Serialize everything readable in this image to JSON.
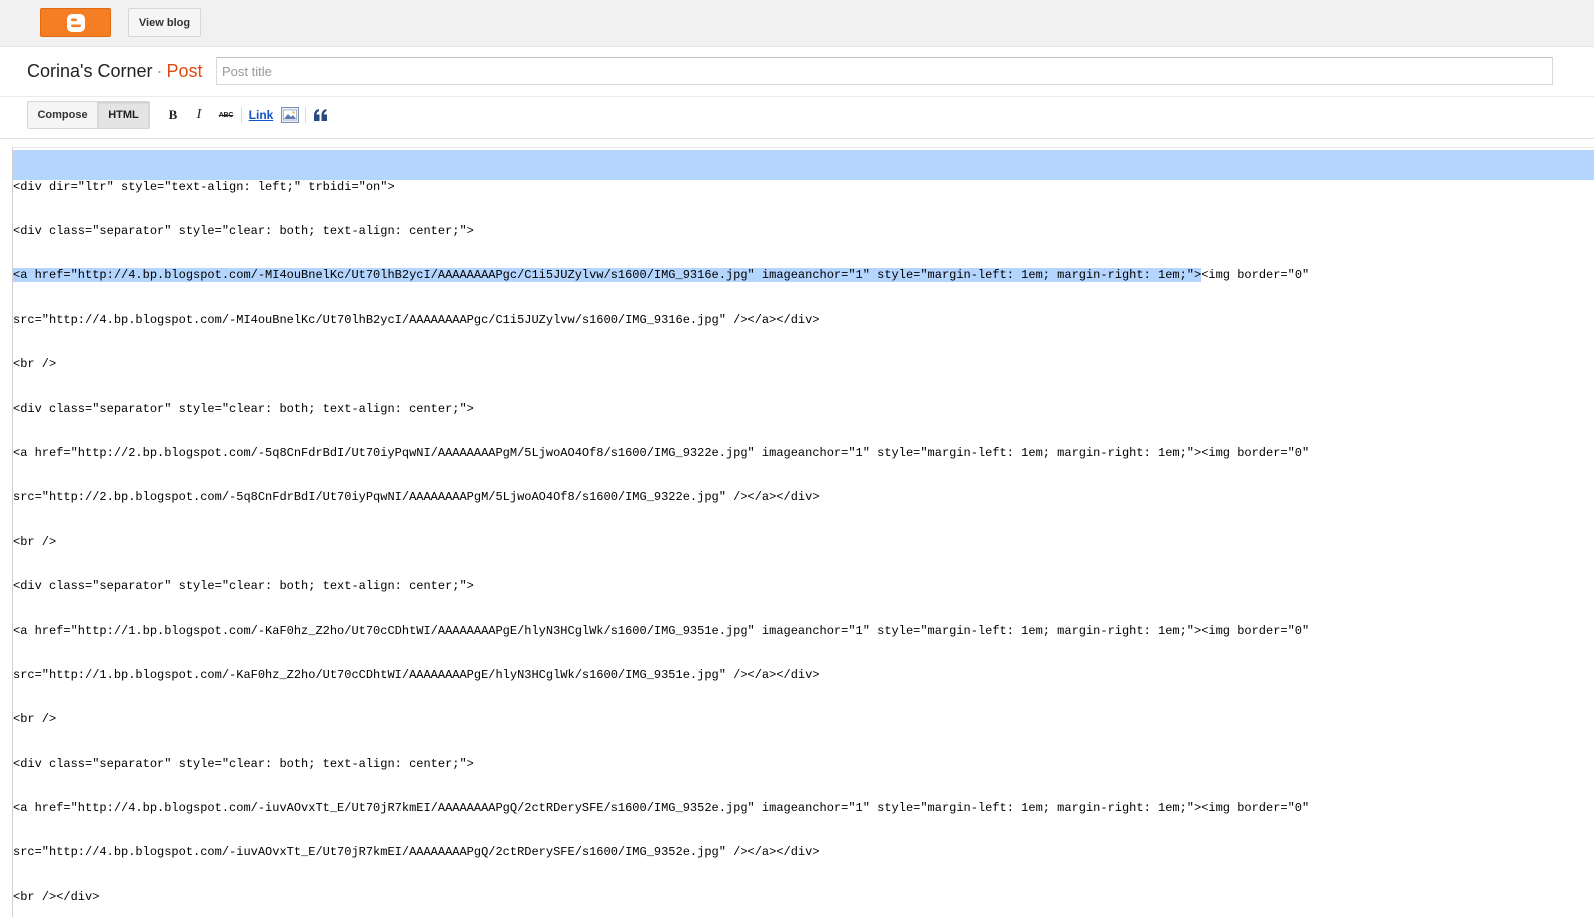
{
  "topbar": {
    "logo_icon": "blogger-logo-icon",
    "view_blog_label": "View blog"
  },
  "titlebar": {
    "blog_name": "Corina's Corner",
    "separator": "·",
    "section": "Post",
    "post_title_placeholder": "Post title",
    "post_title_value": ""
  },
  "toolbar": {
    "compose_label": "Compose",
    "html_label": "HTML",
    "active_mode": "HTML",
    "bold_label": "B",
    "italic_label": "I",
    "strike_label": "ABC",
    "link_label": "Link",
    "image_icon": "insert-image-icon",
    "quote_icon": "blockquote-icon"
  },
  "editor": {
    "selection_color": "#b4d5fe",
    "lines": [
      "<div dir=\"ltr\" style=\"text-align: left;\" trbidi=\"on\">",
      "<div class=\"separator\" style=\"clear: both; text-align: center;\">",
      "<img border=\"0\"",
      "src=\"http://4.bp.blogspot.com/-MI4ouBnelKc/Ut70lhB2ycI/AAAAAAAAPgc/C1i5JUZylvw/s1600/IMG_9316e.jpg\" /></a></div>",
      "<br />",
      "<div class=\"separator\" style=\"clear: both; text-align: center;\">",
      "<a href=\"http://2.bp.blogspot.com/-5q8CnFdrBdI/Ut70iyPqwNI/AAAAAAAAPgM/5LjwoAO4Of8/s1600/IMG_9322e.jpg\" imageanchor=\"1\" style=\"margin-left: 1em; margin-right: 1em;\"><img border=\"0\"",
      "src=\"http://2.bp.blogspot.com/-5q8CnFdrBdI/Ut70iyPqwNI/AAAAAAAAPgM/5LjwoAO4Of8/s1600/IMG_9322e.jpg\" /></a></div>",
      "<br />",
      "<div class=\"separator\" style=\"clear: both; text-align: center;\">",
      "<a href=\"http://1.bp.blogspot.com/-KaF0hz_Z2ho/Ut70cCDhtWI/AAAAAAAAPgE/hlyN3HCglWk/s1600/IMG_9351e.jpg\" imageanchor=\"1\" style=\"margin-left: 1em; margin-right: 1em;\"><img border=\"0\"",
      "src=\"http://1.bp.blogspot.com/-KaF0hz_Z2ho/Ut70cCDhtWI/AAAAAAAAPgE/hlyN3HCglWk/s1600/IMG_9351e.jpg\" /></a></div>",
      "<br />",
      "<div class=\"separator\" style=\"clear: both; text-align: center;\">",
      "<a href=\"http://4.bp.blogspot.com/-iuvAOvxTt_E/Ut70jR7kmEI/AAAAAAAAPgQ/2ctRDerySFE/s1600/IMG_9352e.jpg\" imageanchor=\"1\" style=\"margin-left: 1em; margin-right: 1em;\"><img border=\"0\"",
      "src=\"http://4.bp.blogspot.com/-iuvAOvxTt_E/Ut70jR7kmEI/AAAAAAAAPgQ/2ctRDerySFE/s1600/IMG_9352e.jpg\" /></a></div>",
      "<br /></div>"
    ],
    "selected_line_3": "<a href=\"http://4.bp.blogspot.com/-MI4ouBnelKc/Ut70lhB2ycI/AAAAAAAAPgc/C1i5JUZylvw/s1600/IMG_9316e.jpg\" imageanchor=\"1\" style=\"margin-left: 1em; margin-right: 1em;\">"
  }
}
